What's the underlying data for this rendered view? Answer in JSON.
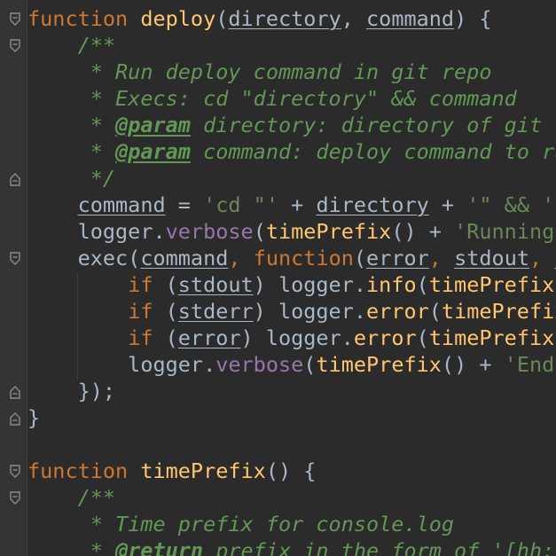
{
  "editor": {
    "lines": [
      [
        [
          "kw",
          "function"
        ],
        [
          "plain",
          " "
        ],
        [
          "fn",
          "deploy"
        ],
        [
          "plain",
          "("
        ],
        [
          "param",
          "directory"
        ],
        [
          "plain",
          ", "
        ],
        [
          "param",
          "command"
        ],
        [
          "plain",
          ") {"
        ]
      ],
      [
        [
          "doc",
          "    /**"
        ]
      ],
      [
        [
          "doc",
          "     * Run deploy command in git repo"
        ]
      ],
      [
        [
          "doc",
          "     * Execs: cd \"directory\" && command"
        ]
      ],
      [
        [
          "doc",
          "     * "
        ],
        [
          "tag",
          "@param"
        ],
        [
          "doc",
          " directory: directory of git re"
        ]
      ],
      [
        [
          "doc",
          "     * "
        ],
        [
          "tag",
          "@param"
        ],
        [
          "doc",
          " command: deploy command to run"
        ]
      ],
      [
        [
          "doc",
          "     */"
        ]
      ],
      [
        [
          "plain",
          "    "
        ],
        [
          "var",
          "command"
        ],
        [
          "plain",
          " = "
        ],
        [
          "str",
          "'cd \"'"
        ],
        [
          "plain",
          " + "
        ],
        [
          "var",
          "directory"
        ],
        [
          "plain",
          " + "
        ],
        [
          "str",
          "'\" && '"
        ]
      ],
      [
        [
          "plain",
          "    logger."
        ],
        [
          "prop",
          "verbose"
        ],
        [
          "plain",
          "("
        ],
        [
          "fncall",
          "timePrefix"
        ],
        [
          "plain",
          "() + "
        ],
        [
          "str",
          "'Running: "
        ]
      ],
      [
        [
          "plain",
          "    exec("
        ],
        [
          "var",
          "command"
        ],
        [
          "punc",
          ","
        ],
        [
          "plain",
          " "
        ],
        [
          "kw",
          "function"
        ],
        [
          "plain",
          "("
        ],
        [
          "param",
          "error"
        ],
        [
          "punc",
          ","
        ],
        [
          "plain",
          " "
        ],
        [
          "param",
          "stdout"
        ],
        [
          "punc",
          ","
        ],
        [
          "plain",
          " "
        ],
        [
          "param",
          "s"
        ]
      ],
      [
        [
          "plain",
          "        "
        ],
        [
          "kw",
          "if"
        ],
        [
          "plain",
          " ("
        ],
        [
          "param",
          "stdout"
        ],
        [
          "plain",
          ") logger."
        ],
        [
          "fncall",
          "info"
        ],
        [
          "plain",
          "("
        ],
        [
          "fncall",
          "timePrefix"
        ],
        [
          "plain",
          "("
        ]
      ],
      [
        [
          "plain",
          "        "
        ],
        [
          "kw",
          "if"
        ],
        [
          "plain",
          " ("
        ],
        [
          "param",
          "stderr"
        ],
        [
          "plain",
          ") logger."
        ],
        [
          "fncall",
          "error"
        ],
        [
          "plain",
          "("
        ],
        [
          "fncall",
          "timePrefix"
        ]
      ],
      [
        [
          "plain",
          "        "
        ],
        [
          "kw",
          "if"
        ],
        [
          "plain",
          " ("
        ],
        [
          "param",
          "error"
        ],
        [
          "plain",
          ") logger."
        ],
        [
          "fncall",
          "error"
        ],
        [
          "plain",
          "("
        ],
        [
          "fncall",
          "timePrefix"
        ],
        [
          "plain",
          "("
        ]
      ],
      [
        [
          "plain",
          "        logger."
        ],
        [
          "prop",
          "verbose"
        ],
        [
          "plain",
          "("
        ],
        [
          "fncall",
          "timePrefix"
        ],
        [
          "plain",
          "() + "
        ],
        [
          "str",
          "'End "
        ]
      ],
      [
        [
          "plain",
          "    });"
        ]
      ],
      [
        [
          "plain",
          "}"
        ]
      ],
      [
        [
          "plain",
          ""
        ]
      ],
      [
        [
          "kw",
          "function"
        ],
        [
          "plain",
          " "
        ],
        [
          "fn",
          "timePrefix"
        ],
        [
          "plain",
          "() {"
        ]
      ],
      [
        [
          "doc",
          "    /**"
        ]
      ],
      [
        [
          "doc",
          "     * Time prefix for console.log"
        ]
      ],
      [
        [
          "doc",
          "     * "
        ],
        [
          "tag",
          "@return"
        ],
        [
          "doc",
          " prefix in the form of '[hh:"
        ]
      ]
    ]
  }
}
